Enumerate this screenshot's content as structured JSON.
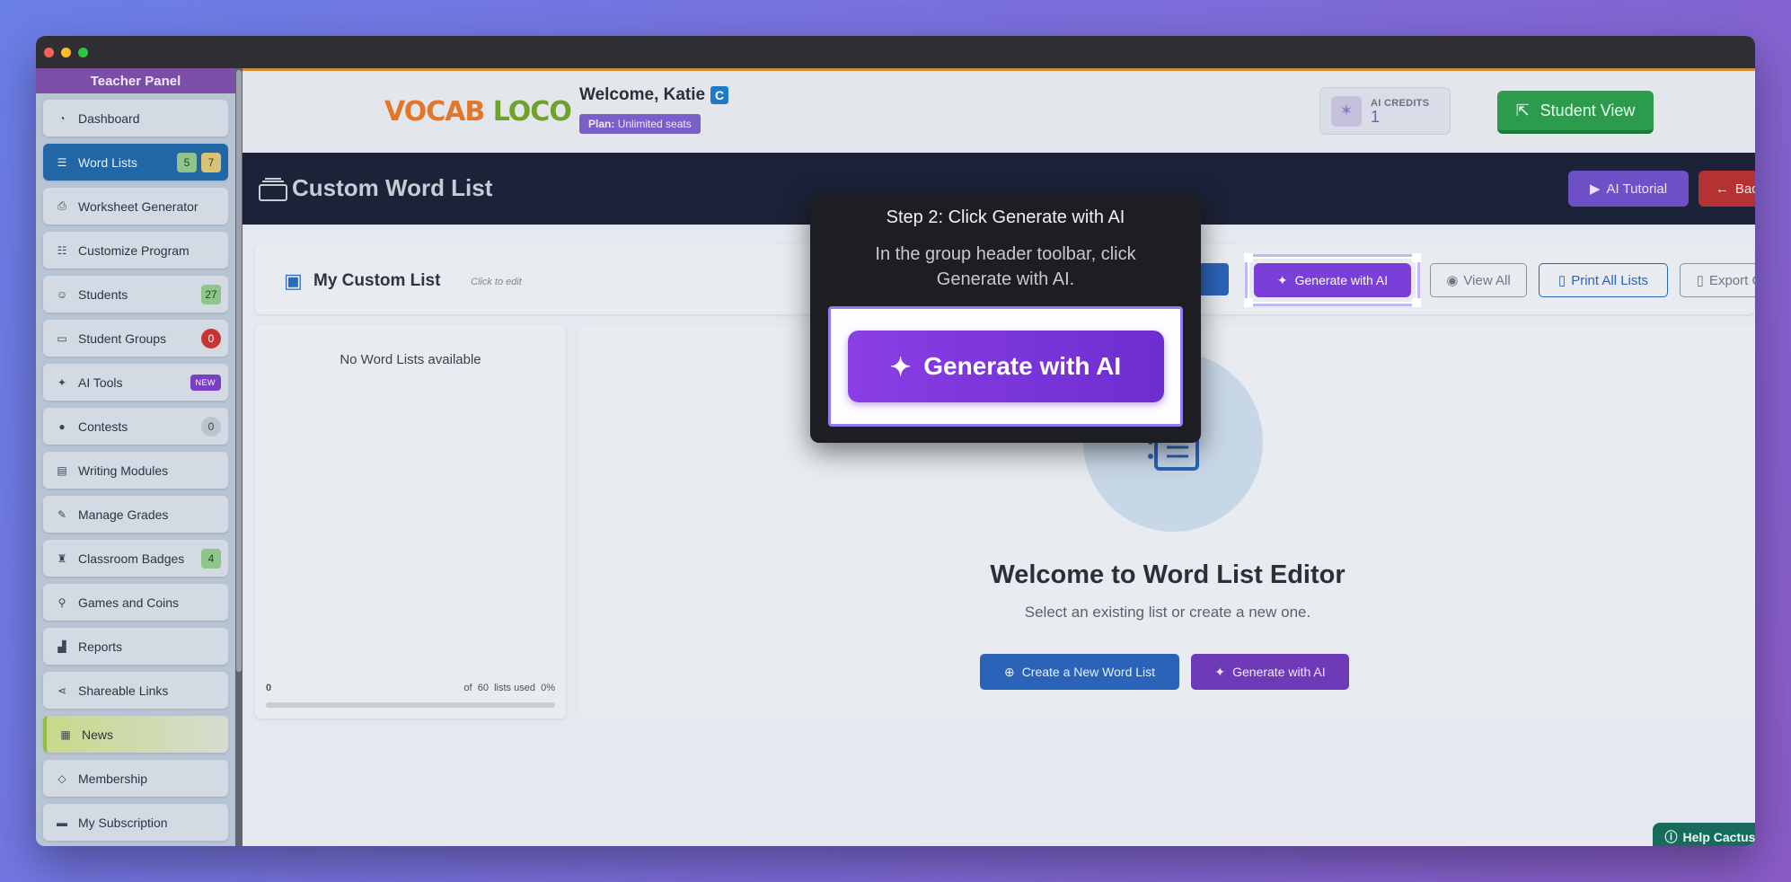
{
  "sidebar": {
    "title": "Teacher Panel",
    "items": [
      {
        "label": "Dashboard"
      },
      {
        "label": "Word Lists",
        "badges": [
          "5",
          "7"
        ]
      },
      {
        "label": "Worksheet Generator"
      },
      {
        "label": "Customize Program"
      },
      {
        "label": "Students",
        "badge": "27"
      },
      {
        "label": "Student Groups",
        "badge": "0"
      },
      {
        "label": "AI Tools",
        "badge": "NEW"
      },
      {
        "label": "Contests",
        "badge": "0"
      },
      {
        "label": "Writing Modules"
      },
      {
        "label": "Manage Grades"
      },
      {
        "label": "Classroom Badges",
        "badge": "4"
      },
      {
        "label": "Games and Coins"
      },
      {
        "label": "Reports"
      },
      {
        "label": "Shareable Links"
      },
      {
        "label": "News"
      },
      {
        "label": "Membership"
      },
      {
        "label": "My Subscription"
      }
    ]
  },
  "topbar": {
    "logo": {
      "part1": "VOCAB",
      "part2": "LOCO"
    },
    "welcome": "Welcome, Katie",
    "welcome_badge": "C",
    "plan_label": "Plan:",
    "plan_value": "Unlimited seats",
    "credits_label": "AI CREDITS",
    "credits_value": "1",
    "student_view": "Student View"
  },
  "header": {
    "title": "Custom Word List",
    "tutorial": "AI Tutorial",
    "back": "Back"
  },
  "listbar": {
    "name": "My Custom List",
    "click_to_edit": "Click to edit",
    "generate": "Generate with AI",
    "view_all": "View All",
    "print_all": "Print All Lists",
    "export_csv": "Export CSV"
  },
  "leftpane": {
    "empty": "No Word Lists available",
    "used_count": "0",
    "of": "of",
    "total": "60",
    "lists_used": "lists used",
    "percent": "0%"
  },
  "rightpane": {
    "title": "Welcome to Word List Editor",
    "subtitle": "Select an existing list or create a new one.",
    "create": "Create a New Word List",
    "generate": "Generate with AI"
  },
  "help": "Help Cactus",
  "tour": {
    "title": "Step 2: Click Generate with AI",
    "body": "In the group header toolbar, click Generate with AI.",
    "button": "Generate with AI"
  },
  "colors": {
    "accent_purple": "#7b3fd9",
    "primary_blue": "#2b63b8",
    "success_green": "#2d9b4d",
    "danger_red": "#b53232"
  }
}
